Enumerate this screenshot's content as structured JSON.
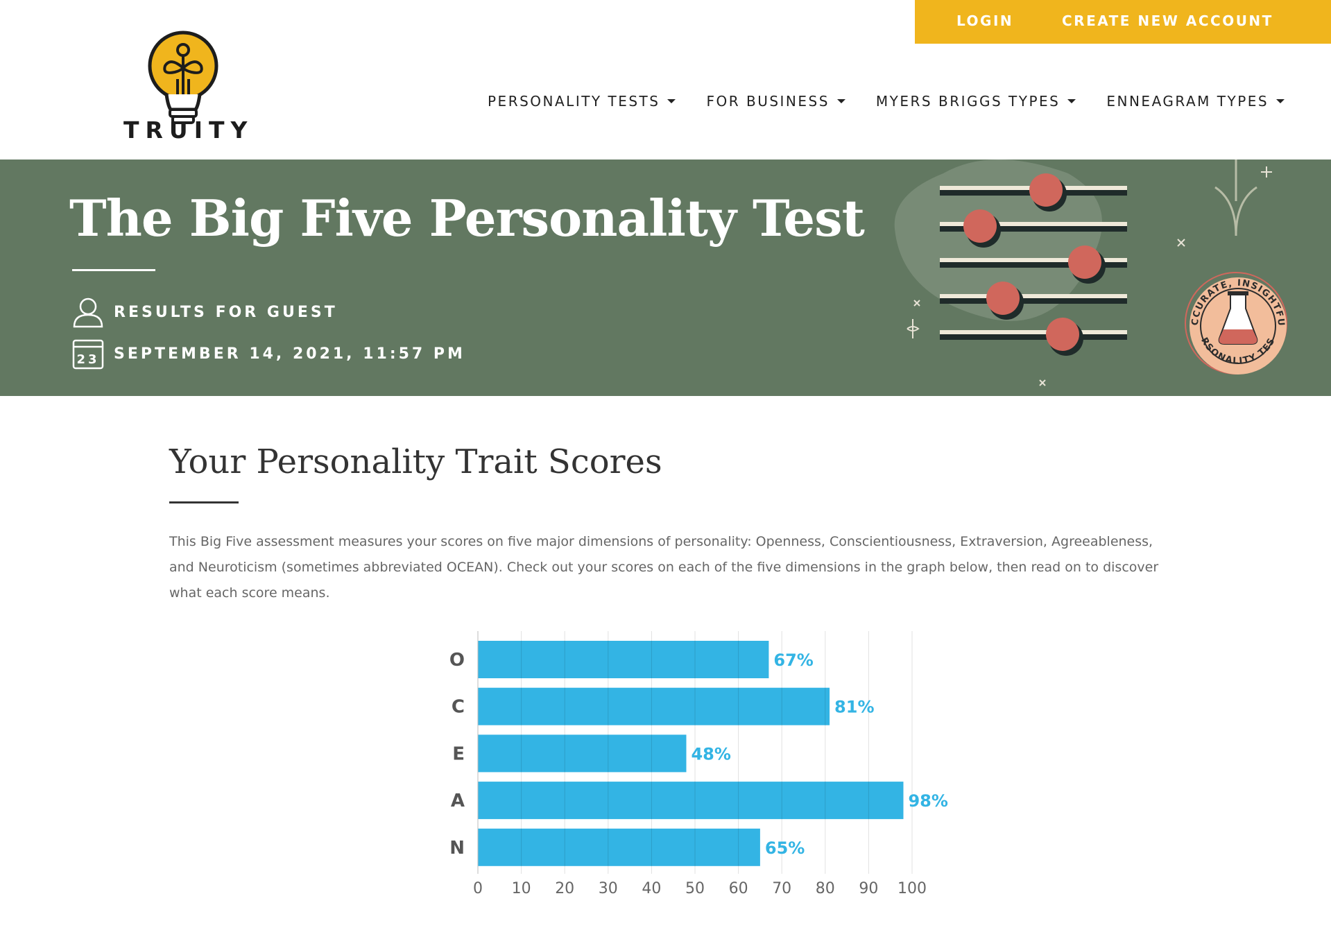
{
  "account": {
    "login_label": "LOGIN",
    "create_label": "CREATE NEW ACCOUNT"
  },
  "logo": {
    "word": "TRUITY"
  },
  "nav": {
    "items": [
      {
        "label": "PERSONALITY TESTS"
      },
      {
        "label": "FOR BUSINESS"
      },
      {
        "label": "MYERS BRIGGS TYPES"
      },
      {
        "label": "ENNEAGRAM TYPES"
      }
    ]
  },
  "hero": {
    "title": "The Big Five Personality Test",
    "results_for": "RESULTS FOR GUEST",
    "date": "SEPTEMBER 14, 2021, 11:57 PM",
    "calendar_day": "23",
    "badge_top": "ACCURATE, INSIGHTFUL",
    "badge_bottom": "PERSONALITY TESTS"
  },
  "section": {
    "title": "Your Personality Trait Scores",
    "intro": "This Big Five assessment measures your scores on five major dimensions of personality: Openness, Conscientiousness, Extraversion, Agreeableness, and Neuroticism (sometimes abbreviated OCEAN). Check out your scores on each of the five dimensions in the graph below, then read on to discover what each score means."
  },
  "colors": {
    "accent_yellow": "#f0b51d",
    "hero_green": "#627861",
    "bar_blue": "#33b4e4",
    "slider_knob": "#d0675c",
    "badge_peach": "#f2bd9b"
  },
  "chart_data": {
    "type": "bar",
    "orientation": "horizontal",
    "categories": [
      "O",
      "C",
      "E",
      "A",
      "N"
    ],
    "values": [
      67,
      81,
      48,
      98,
      65
    ],
    "value_labels": [
      "67%",
      "81%",
      "48%",
      "98%",
      "65%"
    ],
    "xlim": [
      0,
      100
    ],
    "xticks": [
      "0",
      "10",
      "20",
      "30",
      "40",
      "50",
      "60",
      "70",
      "80",
      "90",
      "100"
    ],
    "grid": true,
    "title": "",
    "xlabel": "",
    "ylabel": ""
  }
}
